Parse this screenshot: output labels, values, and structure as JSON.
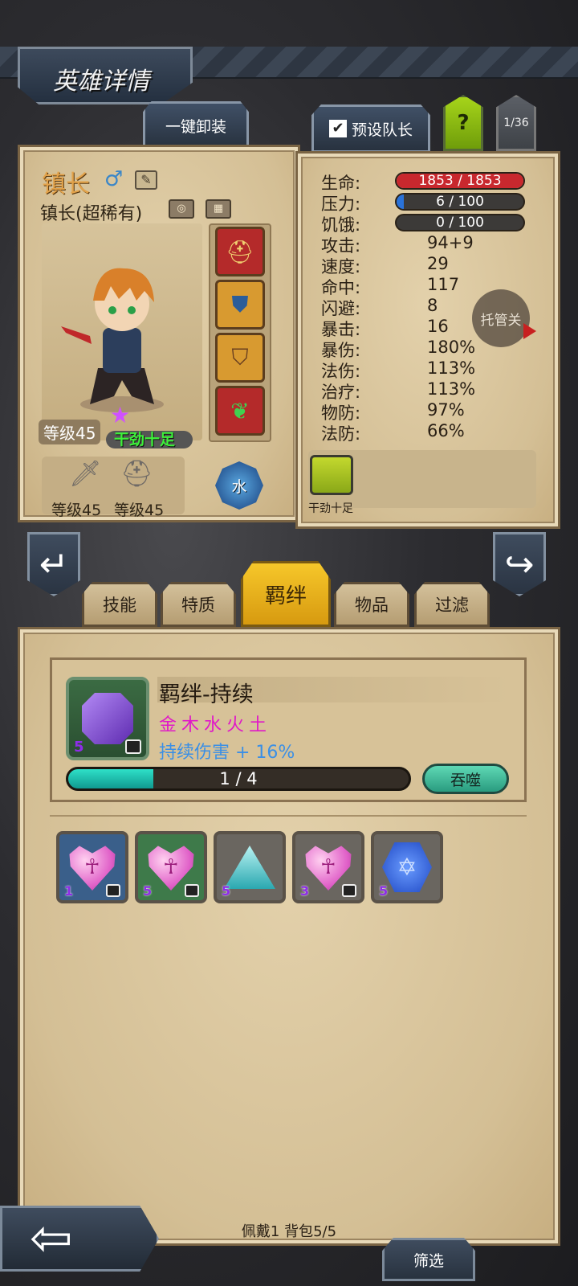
{
  "header": {
    "title": "英雄详情",
    "unequip_all": "一键卸装",
    "preset_leader": "预设队长",
    "checkbox_mark": "✔",
    "help": "?",
    "page_counter": "1/36"
  },
  "hero": {
    "name": "镇长",
    "gender_icon": "male-icon",
    "class_rarity": "镇长(超稀有)",
    "level": "等级45",
    "trait": "干劲十足",
    "element": "水",
    "star_color": "#d050ff",
    "equipment": [
      {
        "name": "helmet-icon",
        "bg": "#b42a2a"
      },
      {
        "name": "armor-icon",
        "bg": "#d89a30"
      },
      {
        "name": "shield-icon",
        "bg": "#d89a30"
      },
      {
        "name": "leaf-blade-icon",
        "bg": "#b42a2a"
      }
    ],
    "gear": [
      {
        "name": "sword-icon",
        "level": "等级45"
      },
      {
        "name": "helm-icon",
        "level": "等级45"
      }
    ]
  },
  "stats": {
    "hp_label": "生命:",
    "hp_value": "1853 / 1853",
    "hp_fraction": 1.0,
    "stress_label": "压力:",
    "stress_value": "6 / 100",
    "stress_fraction": 0.06,
    "hunger_label": "饥饿:",
    "hunger_value": "0 / 100",
    "hunger_fraction": 0.0,
    "rows": [
      {
        "label": "攻击:",
        "value": "94+9"
      },
      {
        "label": "速度:",
        "value": "29"
      },
      {
        "label": "命中:",
        "value": "117"
      },
      {
        "label": "闪避:",
        "value": "8"
      },
      {
        "label": "暴击:",
        "value": "16"
      },
      {
        "label": "暴伤:",
        "value": "180%"
      },
      {
        "label": "法伤:",
        "value": "113%"
      },
      {
        "label": "治疗:",
        "value": "113%"
      },
      {
        "label": "物防:",
        "value": "97%"
      },
      {
        "label": "法防:",
        "value": "66%"
      }
    ],
    "auto_level": "托管关",
    "skill_label": "干劲十足"
  },
  "tabs": [
    {
      "label": "技能",
      "active": false
    },
    {
      "label": "特质",
      "active": false
    },
    {
      "label": "羁绊",
      "active": true
    },
    {
      "label": "物品",
      "active": false
    },
    {
      "label": "过滤",
      "active": false
    }
  ],
  "bond": {
    "gem_level": "5",
    "title": "羁绊-持续",
    "elements": "金木水火土",
    "effect": "持续伤害 + 16%",
    "progress_text": "1 / 4",
    "progress_fraction": 0.25,
    "devour": "吞噬"
  },
  "inventory": [
    {
      "type": "heart-gem-icon",
      "level": "1",
      "locked": true,
      "bg": "#3a5f8a"
    },
    {
      "type": "heart-gem-icon",
      "level": "5",
      "locked": true,
      "bg": "#3e7a4a"
    },
    {
      "type": "triangle-gem-icon",
      "level": "5",
      "locked": false,
      "bg": "#6a6660"
    },
    {
      "type": "heart-gem-icon",
      "level": "3",
      "locked": true,
      "bg": "#6a6660"
    },
    {
      "type": "star-gem-icon",
      "level": "5",
      "locked": false,
      "bg": "#6a6660"
    }
  ],
  "footer": {
    "status": "佩戴1 背包5/5",
    "filter": "筛选",
    "back_arrow": "⇦"
  },
  "nav": {
    "prev": "↵",
    "next": "↪"
  }
}
